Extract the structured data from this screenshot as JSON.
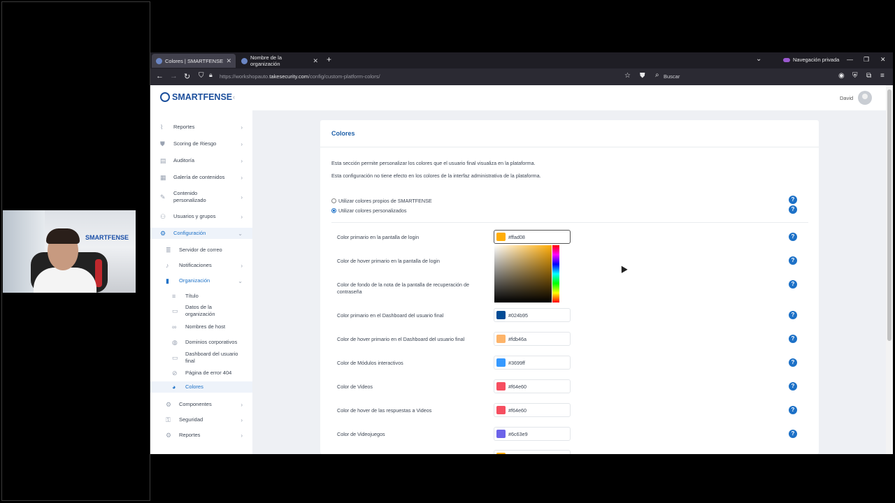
{
  "browser": {
    "tabs": [
      {
        "label": "Colores | SMARTFENSE"
      },
      {
        "label": "Nombre de la organización"
      }
    ],
    "private_label": "Navegación privada",
    "url_prefix": "https://workshopauto.",
    "url_domain": "takesecurity.com",
    "url_path": "/config/custom-platform-colors/",
    "search_placeholder": "Buscar"
  },
  "app": {
    "brand": "SMARTFENSE",
    "user": "David"
  },
  "sidebar": {
    "items": [
      {
        "label": "Reportes",
        "icon": "chart-icon"
      },
      {
        "label": "Scoring de Riesgo",
        "icon": "shield-icon"
      },
      {
        "label": "Auditoría",
        "icon": "audit-icon"
      },
      {
        "label": "Galería de contenidos",
        "icon": "gallery-icon"
      },
      {
        "label": "Contenido personalizado",
        "icon": "edit-icon"
      },
      {
        "label": "Usuarios y grupos",
        "icon": "users-icon"
      },
      {
        "label": "Configuración",
        "icon": "gear-icon"
      },
      {
        "label": "Servidor de correo",
        "icon": "server-icon"
      },
      {
        "label": "Notificaciones",
        "icon": "bell-icon"
      },
      {
        "label": "Organización",
        "icon": "building-icon"
      },
      {
        "label": "Título",
        "icon": "text-icon"
      },
      {
        "label": "Datos de la organización",
        "icon": "card-icon"
      },
      {
        "label": "Nombres de host",
        "icon": "link-icon"
      },
      {
        "label": "Dominios corporativos",
        "icon": "globe-icon"
      },
      {
        "label": "Dashboard del usuario final",
        "icon": "monitor-icon"
      },
      {
        "label": "Página de error 404",
        "icon": "error-icon"
      },
      {
        "label": "Colores",
        "icon": "palette-icon"
      },
      {
        "label": "Componentes",
        "icon": "components-icon"
      },
      {
        "label": "Seguridad",
        "icon": "lock-icon"
      },
      {
        "label": "Reportes",
        "icon": "report-icon"
      }
    ]
  },
  "main": {
    "title": "Colores",
    "desc1": "Esta sección permite personalizar los colores que el usuario final visualiza en la plataforma.",
    "desc2": "Esta configuración no tiene efecto en los colores de la interfaz administrativa de la plataforma.",
    "option1": "Utilizar colores propios de SMARTFENSE",
    "option2": "Utilizar colores personalizados",
    "selected_option": 2,
    "help_symbol": "?",
    "rows": [
      {
        "label": "Color primario en la pantalla de login",
        "value": "#ffad08",
        "color": "#ffad08"
      },
      {
        "label": "Color de hover primario en la pantalla de login",
        "value": "",
        "color": ""
      },
      {
        "label": "Color de fondo de la nota de la pantalla de recuperación de contraseña",
        "value": "",
        "color": ""
      },
      {
        "label": "Color primario en el Dashboard del usuario final",
        "value": "#024b95",
        "color": "#024b95"
      },
      {
        "label": "Color de hover primario en el Dashboard del usuario final",
        "value": "#fdb46a",
        "color": "#fdb46a"
      },
      {
        "label": "Color de Módulos interactivos",
        "value": "#3699ff",
        "color": "#3699ff"
      },
      {
        "label": "Color de Videos",
        "value": "#f64e60",
        "color": "#f64e60"
      },
      {
        "label": "Color de hover de las respuestas a Videos",
        "value": "#f64e60",
        "color": "#f64e60"
      },
      {
        "label": "Color de Videojuegos",
        "value": "#6c63e9",
        "color": "#6c63e9"
      }
    ]
  },
  "colors": {
    "accent": "#1d71c7",
    "brand": "#1c4f9c"
  }
}
